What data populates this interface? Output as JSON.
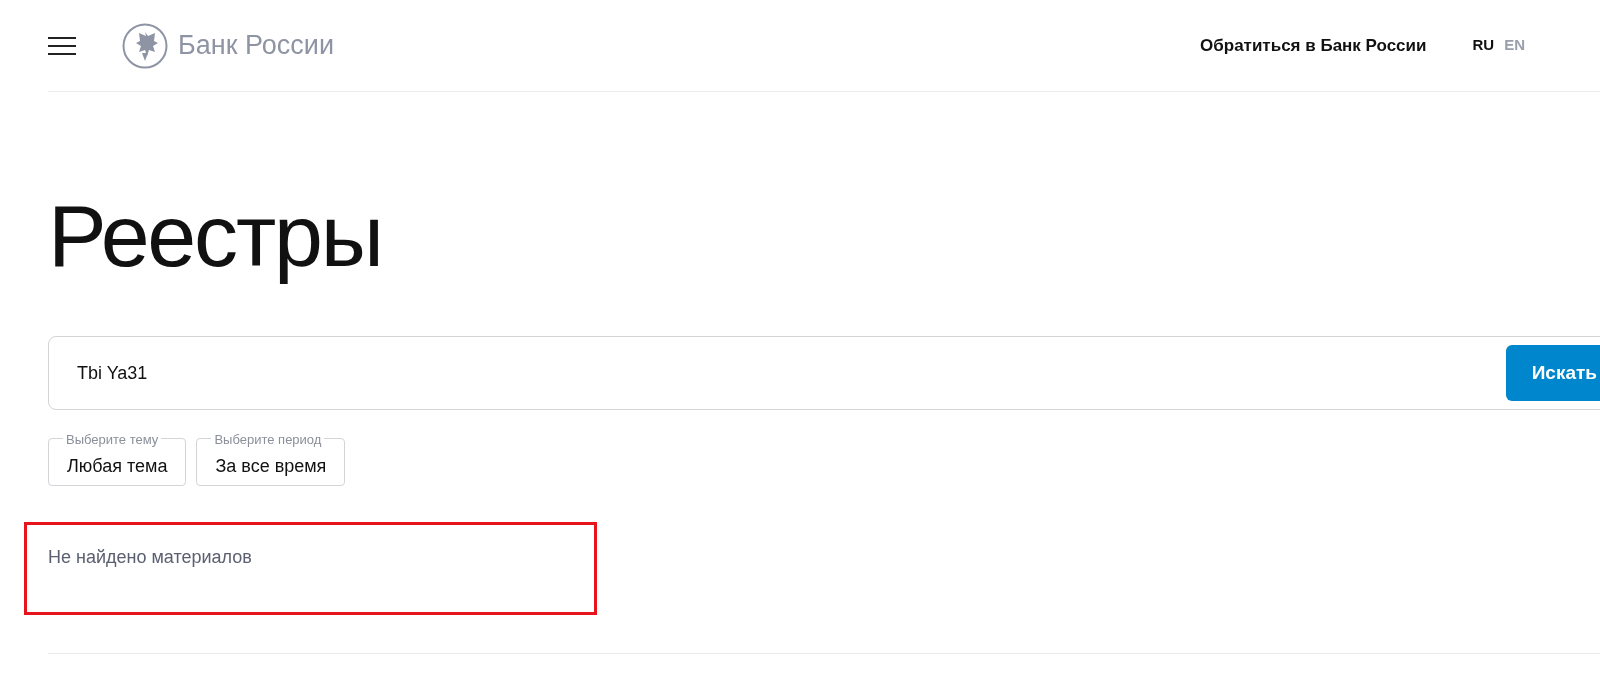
{
  "header": {
    "logo_text": "Банк России",
    "contact_link": "Обратиться в Банк России",
    "languages": [
      {
        "label": "RU",
        "selected": true
      },
      {
        "label": "EN",
        "selected": false
      }
    ]
  },
  "title": "Реестры",
  "search": {
    "value": "Tbi Ya31",
    "button": "Искать"
  },
  "filters": [
    {
      "label": "Выберите тему",
      "value": "Любая тема"
    },
    {
      "label": "Выберите период",
      "value": "За все время"
    }
  ],
  "results": {
    "message": "Не найдено материалов",
    "highlighted": true
  }
}
